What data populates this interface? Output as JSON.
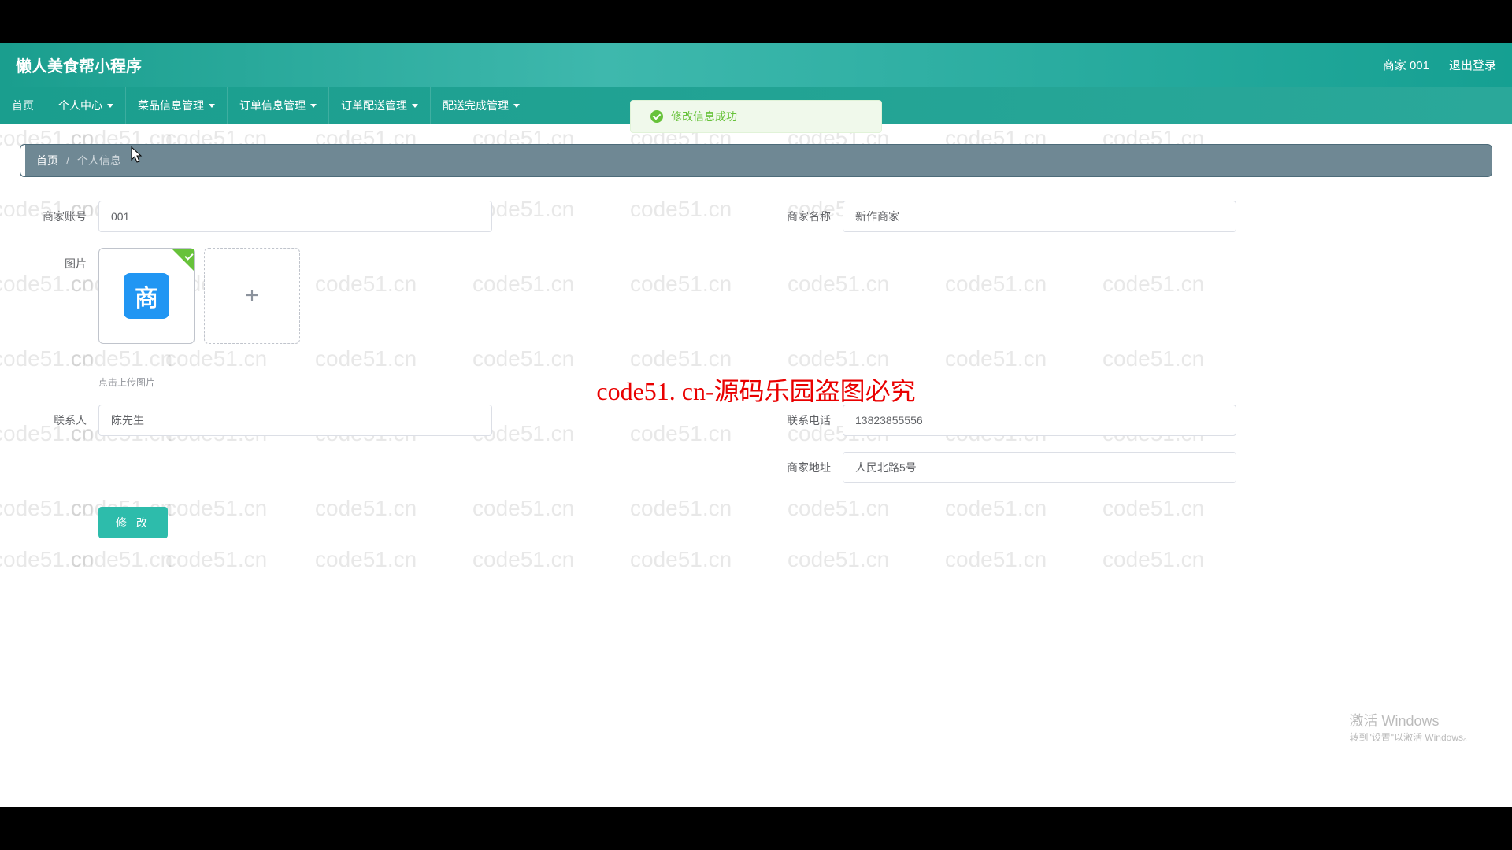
{
  "header": {
    "title": "懒人美食帮小程序",
    "user_label": "商家 001",
    "logout": "退出登录"
  },
  "nav": {
    "items": [
      {
        "label": "首页",
        "dropdown": false
      },
      {
        "label": "个人中心",
        "dropdown": true
      },
      {
        "label": "菜品信息管理",
        "dropdown": true
      },
      {
        "label": "订单信息管理",
        "dropdown": true
      },
      {
        "label": "订单配送管理",
        "dropdown": true
      },
      {
        "label": "配送完成管理",
        "dropdown": true
      }
    ]
  },
  "toast": {
    "message": "修改信息成功"
  },
  "breadcrumb": {
    "home": "首页",
    "sep": "/",
    "current": "个人信息"
  },
  "form": {
    "account_label": "商家账号",
    "account_value": "001",
    "name_label": "商家名称",
    "name_value": "新作商家",
    "image_label": "图片",
    "image_icon_text": "商",
    "image_hint": "点击上传图片",
    "contact_label": "联系人",
    "contact_value": "陈先生",
    "phone_label": "联系电话",
    "phone_value": "13823855556",
    "address_label": "商家地址",
    "address_value": "人民北路5号",
    "submit_label": "修 改"
  },
  "watermark": {
    "repeated": "code51.cn",
    "center": "code51. cn-源码乐园盗图必究"
  },
  "windows": {
    "line1": "激活 Windows",
    "line2": "转到\"设置\"以激活 Windows。"
  }
}
